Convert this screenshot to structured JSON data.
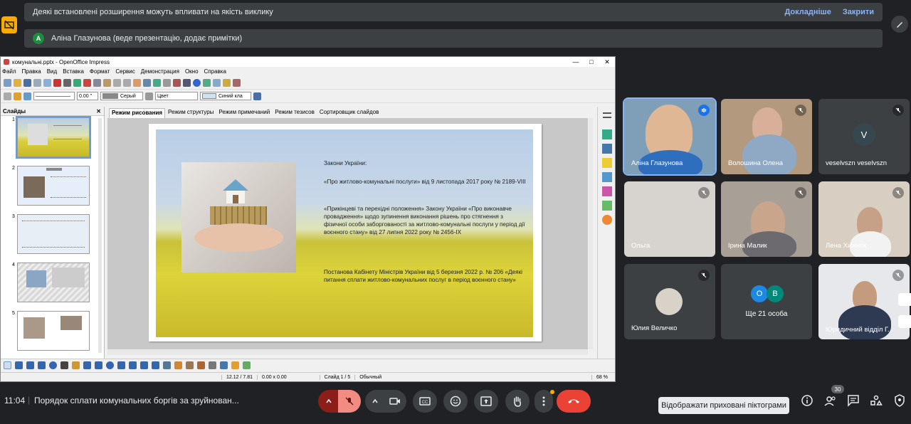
{
  "banner": {
    "message": "Деякі встановлені розширення можуть впливати на якість виклику",
    "details_link": "Докладніше",
    "close_link": "Закрити"
  },
  "presenter": {
    "avatar_letter": "А",
    "text": "Аліна Глазунова (веде презентацію, додає примітки)"
  },
  "impress": {
    "title": "комунальні.pptx - OpenOffice Impress",
    "menu": [
      "Файл",
      "Правка",
      "Вид",
      "Вставка",
      "Формат",
      "Сервис",
      "Демонстрация",
      "Окно",
      "Справка"
    ],
    "line_width": "0.00 \"",
    "fill_color": "Серый",
    "color_mode": "Цвет",
    "line_color": "Синий кла",
    "slides_header": "Слайды",
    "view_tabs": [
      "Режим рисования",
      "Режим структуры",
      "Режим примечаний",
      "Режим тезисов",
      "Сортировщик слайдов"
    ],
    "slide_numbers": [
      "1",
      "2",
      "3",
      "4",
      "5"
    ],
    "status": {
      "position": "12.12 / 7.81",
      "size": "0.00 x 0.00",
      "slide": "Слайд 1 / 5",
      "layout": "Обычный",
      "zoom": "68 %"
    }
  },
  "slide": {
    "heading": "Закони України:",
    "p1": "«Про житлово-комунальні послуги» від 9 листопада 2017 року № 2189-VIII",
    "p2": "«Прикінцеві та перехідні положення» Закону України «Про виконавче провадження» щодо зупинення виконання рішень про стягнення з фізичної особи заборгованості за житлово-комунальні послуги у період дії воєнного стану» від 27 липня 2022 року № 2456-IX",
    "p3": "Постанова Кабінету Міністрів України  від 5 березня 2022 р. № 206 «Деякі питання сплати житлово-комунальних послуг в період воєнного стану»"
  },
  "participants": [
    {
      "name": "Аліна Глазунова"
    },
    {
      "name": "Волошина Олена"
    },
    {
      "name": "veselvszn veselvszn",
      "avatar_letter": "V"
    },
    {
      "name": "Ольга"
    },
    {
      "name": "Ірина Малик"
    },
    {
      "name": "Лена Хижняк"
    },
    {
      "name": "Юлия Величко"
    },
    {
      "name": "Ще 21 особа",
      "letters": [
        "О",
        "В"
      ]
    },
    {
      "name": "Юридичний відділ Г..."
    }
  ],
  "bottom": {
    "time": "11:04",
    "separator": "|",
    "meeting_title": "Порядок сплати комунальних боргів за зруйнован...",
    "tooltip": "Відображати приховані піктограми",
    "people_count": "30"
  },
  "colors": {
    "bg": "#202124",
    "end_call": "#ea4335",
    "mic_off": "#8c1d18",
    "accent": "#8ab4f8"
  }
}
